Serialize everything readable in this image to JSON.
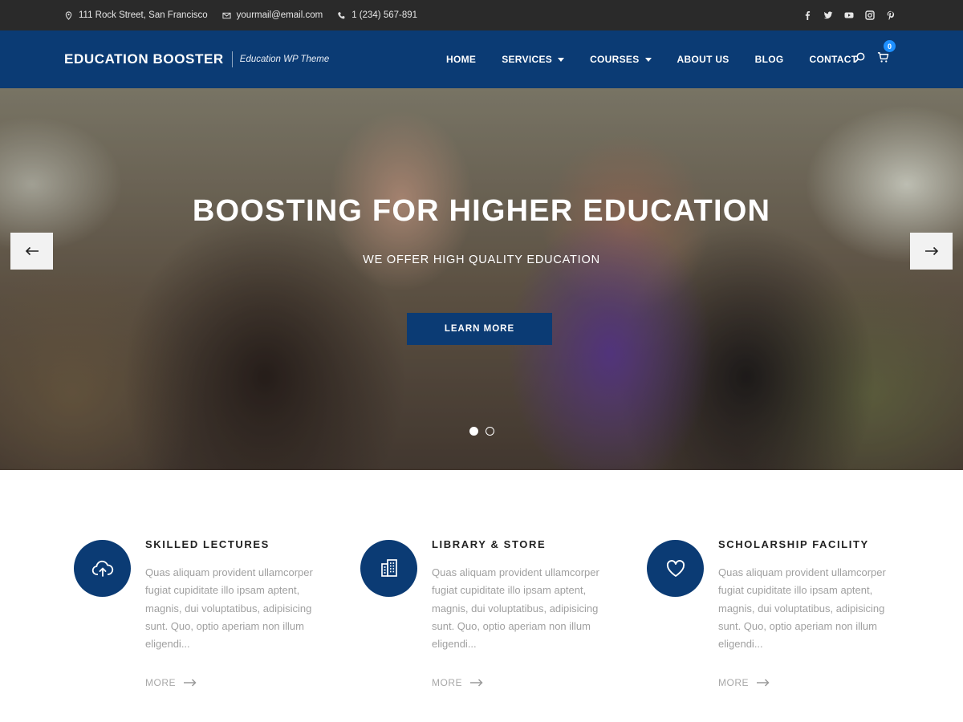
{
  "topbar": {
    "address": "111 Rock Street, San Francisco",
    "email": "yourmail@email.com",
    "phone": "1 (234) 567-891",
    "icons": {
      "address": "map-pin-icon",
      "email": "envelope-icon",
      "phone": "phone-icon"
    },
    "social": [
      "facebook-icon",
      "twitter-icon",
      "youtube-icon",
      "instagram-icon",
      "pinterest-icon"
    ]
  },
  "header": {
    "brand_name": "EDUCATION BOOSTER",
    "tagline": "Education WP Theme",
    "nav": [
      {
        "label": "HOME",
        "has_dropdown": false
      },
      {
        "label": "SERVICES",
        "has_dropdown": true
      },
      {
        "label": "COURSES",
        "has_dropdown": true
      },
      {
        "label": "ABOUT US",
        "has_dropdown": false
      },
      {
        "label": "BLOG",
        "has_dropdown": false
      },
      {
        "label": "CONTACT",
        "has_dropdown": false
      }
    ],
    "cart_count": "0",
    "icons": {
      "search": "search-icon",
      "cart": "cart-icon"
    }
  },
  "hero": {
    "title": "BOOSTING FOR HIGHER EDUCATION",
    "subtitle": "WE OFFER HIGH QUALITY EDUCATION",
    "button_label": "LEARN MORE",
    "slides_total": 2,
    "active_slide": 1
  },
  "features": [
    {
      "icon": "cloud-upload-icon",
      "title": "SKILLED LECTURES",
      "text": "Quas aliquam provident ullamcorper fugiat cupiditate illo ipsam aptent, magnis, dui voluptatibus, adipisicing sunt. Quo, optio aperiam non illum eligendi...",
      "more": "MORE"
    },
    {
      "icon": "building-icon",
      "title": "LIBRARY & STORE",
      "text": "Quas aliquam provident ullamcorper fugiat cupiditate illo ipsam aptent, magnis, dui voluptatibus, adipisicing sunt. Quo, optio aperiam non illum eligendi...",
      "more": "MORE"
    },
    {
      "icon": "heart-icon",
      "title": "SCHOLARSHIP FACILITY",
      "text": "Quas aliquam provident ullamcorper fugiat cupiditate illo ipsam aptent, magnis, dui voluptatibus, adipisicing sunt. Quo, optio aperiam non illum eligendi...",
      "more": "MORE"
    }
  ],
  "colors": {
    "primary": "#0b3b74",
    "topbar": "#2a2a2a",
    "cart_badge": "#1e90ff",
    "muted_text": "#a0a0a0"
  }
}
